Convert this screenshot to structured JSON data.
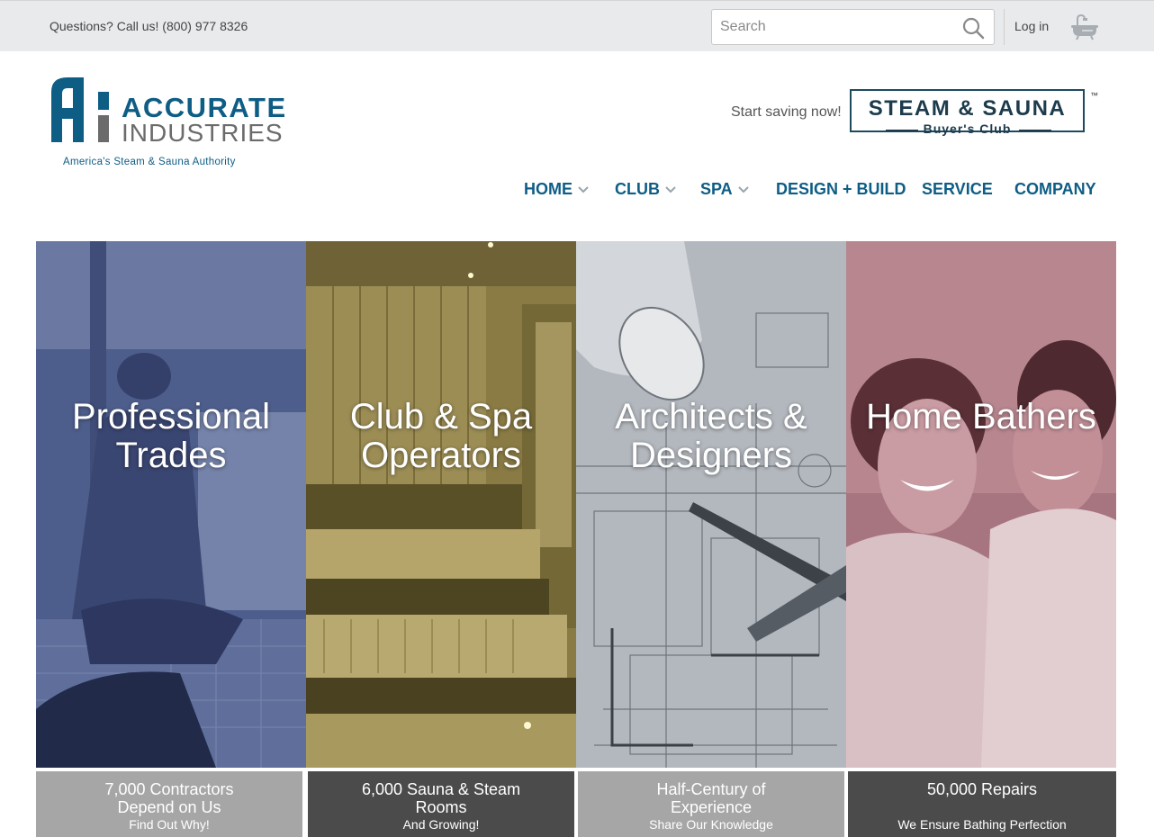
{
  "topbar": {
    "phone": "Questions? Call us! (800) 977 8326",
    "search_placeholder": "Search",
    "login": "Log in"
  },
  "icons": {
    "search": "search-icon",
    "cart": "bathtub-cart-icon",
    "nav_dropdown": "chevron-down-icon"
  },
  "logo": {
    "word1": "ACCURATE",
    "word2": "INDUSTRIES",
    "tagline": "America's Steam & Sauna Authority"
  },
  "promo": {
    "text": "Start saving now!",
    "club_line1": "STEAM & SAUNA",
    "club_line2": "Buyer's Club",
    "trademark": "™"
  },
  "nav": [
    {
      "label": "HOME",
      "dropdown": true
    },
    {
      "label": "CLUB",
      "dropdown": true
    },
    {
      "label": "SPA",
      "dropdown": true
    },
    {
      "label": "DESIGN + BUILD",
      "dropdown": false
    },
    {
      "label": "SERVICE",
      "dropdown": false
    },
    {
      "label": "COMPANY",
      "dropdown": false
    }
  ],
  "panels": [
    {
      "title": "Professional\nTrades",
      "tint": "#4a5a8a"
    },
    {
      "title": "Club & Spa\nOperators",
      "tint": "#8a7a3e"
    },
    {
      "title": "Architects &\nDesigners",
      "tint": "#8f959c"
    },
    {
      "title": "Home Bathers",
      "tint": "#9e6872"
    }
  ],
  "captions": [
    {
      "main": "7,000 Contractors\nDepend on Us",
      "sub": "Find Out Why!",
      "bg": "#a6a6a6"
    },
    {
      "main": "6,000 Sauna & Steam\nRooms",
      "sub": "And Growing!",
      "bg": "#4b4b4b"
    },
    {
      "main": "Half-Century of\nExperience",
      "sub": "Share Our Knowledge",
      "bg": "#a6a6a6"
    },
    {
      "main": "50,000 Repairs",
      "sub": "We Ensure Bathing Perfection",
      "bg": "#4b4b4b"
    }
  ],
  "colors": {
    "brand_blue": "#0e5d85",
    "topbar_bg": "#e9eaec"
  }
}
